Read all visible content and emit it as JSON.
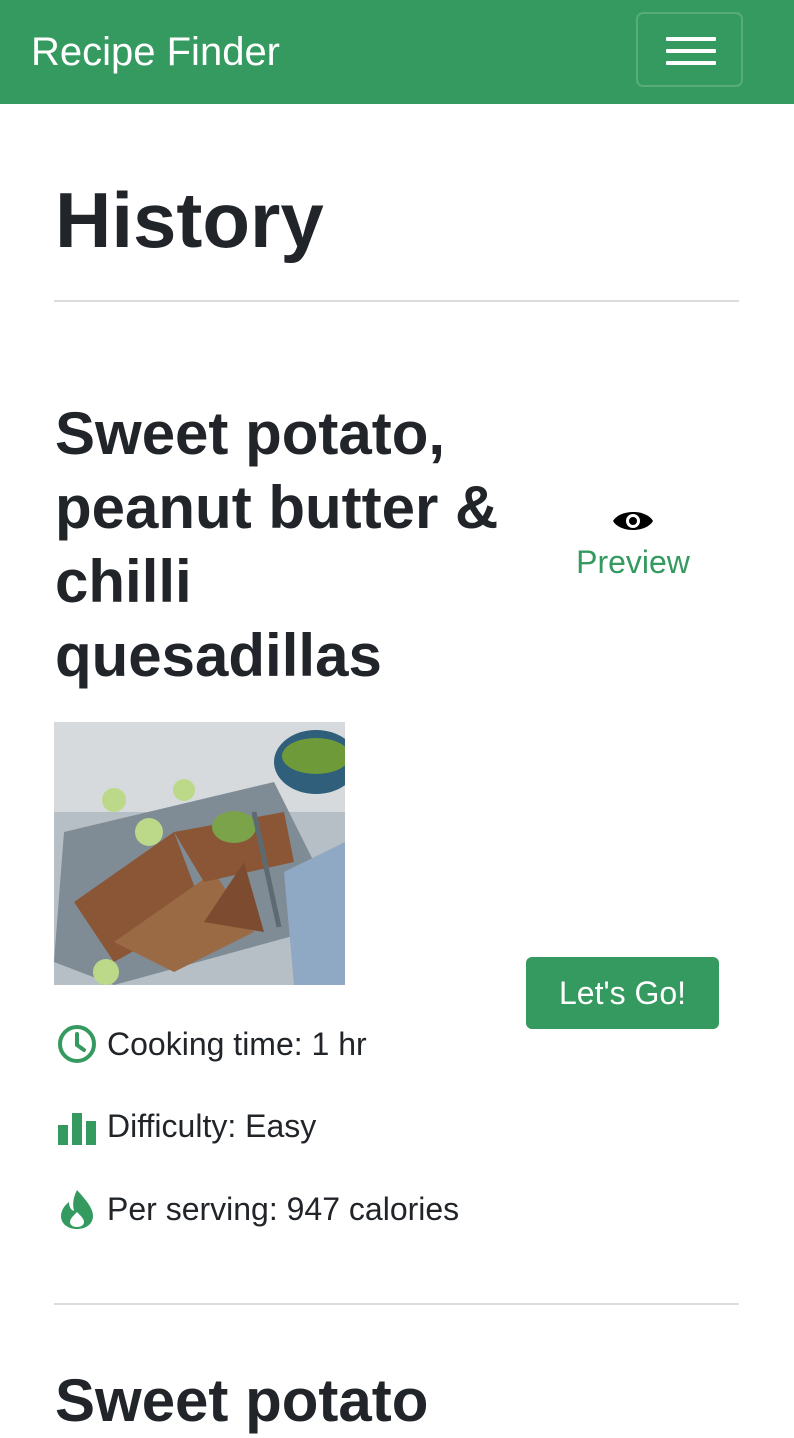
{
  "navbar": {
    "brand": "Recipe Finder",
    "toggle_icon": "hamburger-menu-icon",
    "background_color": "#349a5f"
  },
  "page": {
    "title": "History"
  },
  "recipes": [
    {
      "title": "Sweet potato, peanut butter & chilli quesadillas",
      "preview_label": "Preview",
      "preview_icon": "eye-icon",
      "image_alt": "quesadillas photo",
      "action_label": "Let's Go!",
      "cooking_time": "Cooking time: 1 hr",
      "difficulty": "Difficulty: Easy",
      "calories": "Per serving: 947 calories"
    },
    {
      "title": "Sweet potato"
    }
  ],
  "colors": {
    "accent": "#349a5f",
    "text": "#212529",
    "divider": "#dcdcdc"
  }
}
